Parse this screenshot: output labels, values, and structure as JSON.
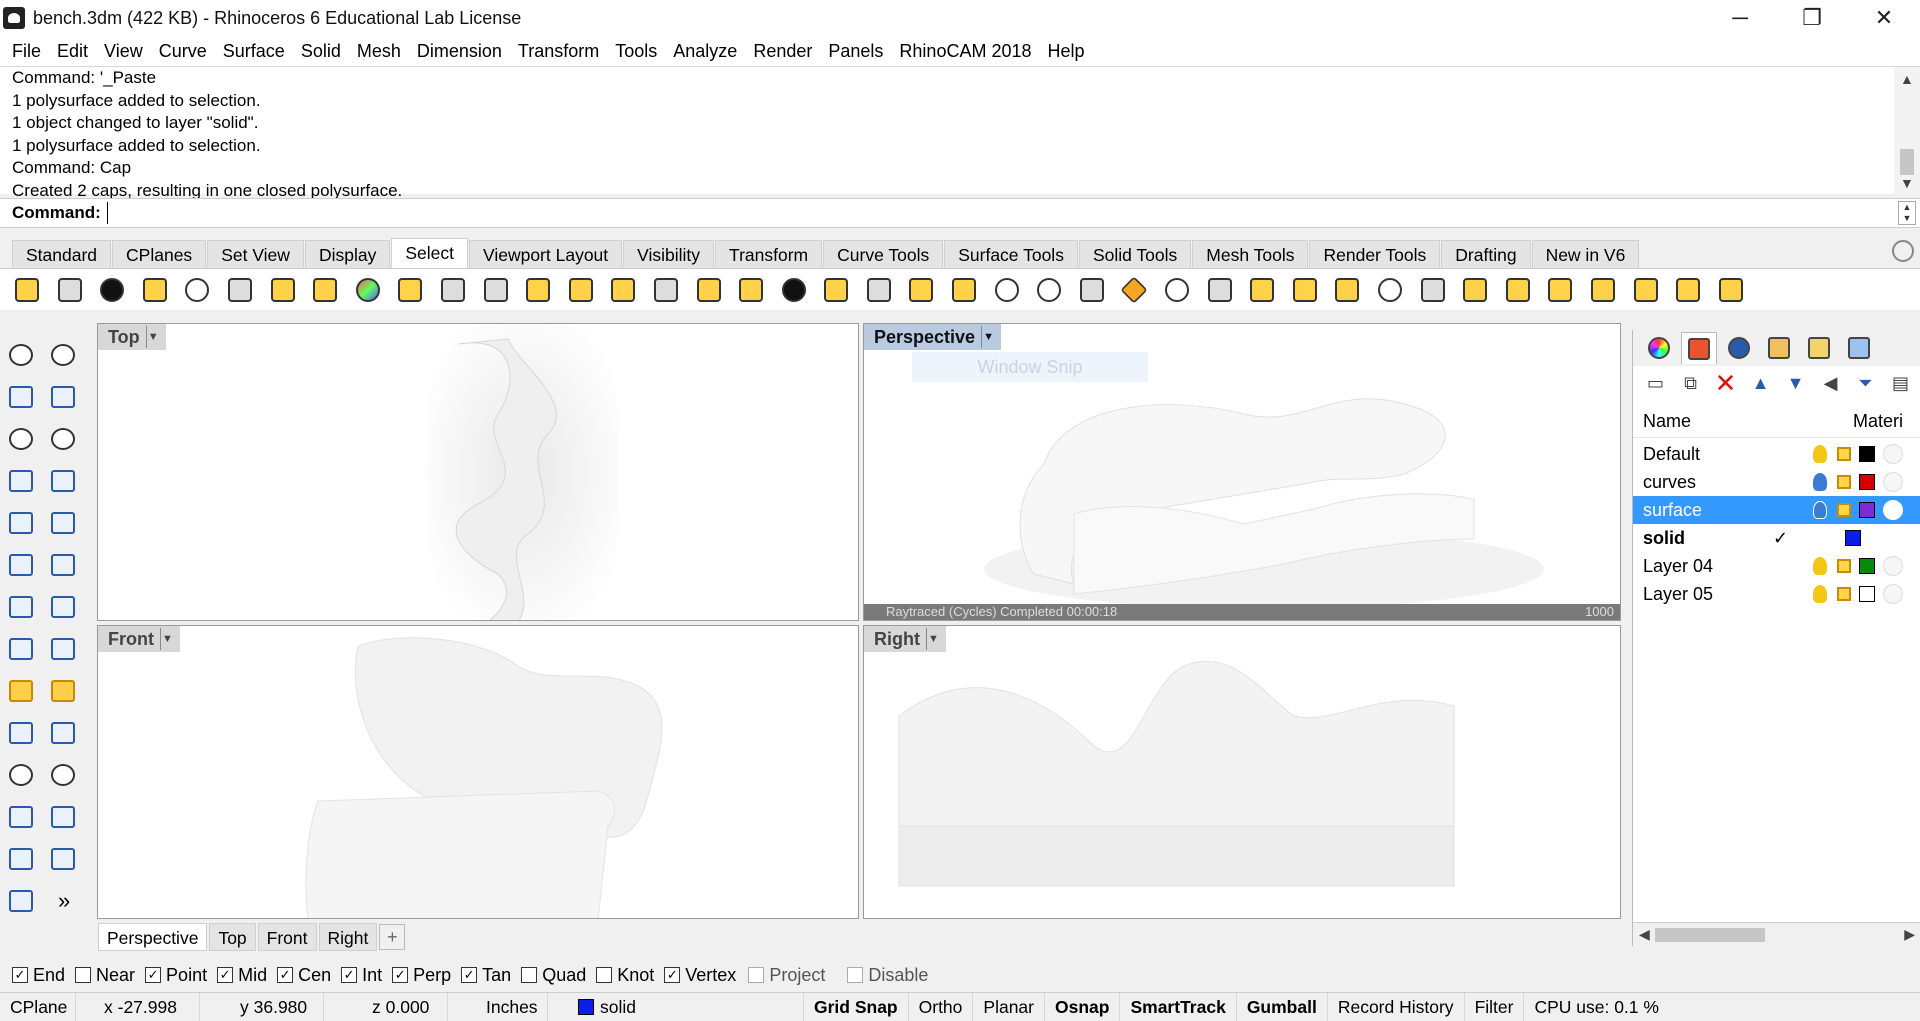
{
  "window": {
    "title": "bench.3dm (422 KB) - Rhinoceros 6 Educational Lab License",
    "minimize": "─",
    "maximize": "❐",
    "close": "✕"
  },
  "menu": [
    "File",
    "Edit",
    "View",
    "Curve",
    "Surface",
    "Solid",
    "Mesh",
    "Dimension",
    "Transform",
    "Tools",
    "Analyze",
    "Render",
    "Panels",
    "RhinoCAM 2018",
    "Help"
  ],
  "command_history": [
    "Command: '_Paste",
    "1 polysurface added to selection.",
    "1 object changed to layer \"solid\".",
    "1 polysurface added to selection.",
    "Command: Cap",
    "Created 2 caps, resulting in one closed polysurface."
  ],
  "command_prompt": {
    "label": "Command:",
    "value": ""
  },
  "toolbar_tabs": [
    "Standard",
    "CPlanes",
    "Set View",
    "Display",
    "Select",
    "Viewport Layout",
    "Visibility",
    "Transform",
    "Curve Tools",
    "Surface Tools",
    "Solid Tools",
    "Mesh Tools",
    "Render Tools",
    "Drafting",
    "New in V6"
  ],
  "active_toolbar_tab": "Select",
  "viewports": {
    "top": {
      "label": "Top"
    },
    "perspective": {
      "label": "Perspective",
      "snip_overlay": "Window Snip",
      "status_left": "Raytraced (Cycles)    Completed    00:00:18",
      "status_right": "1000"
    },
    "front": {
      "label": "Front"
    },
    "right": {
      "label": "Right"
    }
  },
  "viewport_tabs": [
    "Perspective",
    "Top",
    "Front",
    "Right"
  ],
  "layers_panel": {
    "header_name": "Name",
    "header_material": "Materi",
    "layers": [
      {
        "name": "Default",
        "color": "#000000",
        "bulb": "#f5c518"
      },
      {
        "name": "curves",
        "color": "#d40000",
        "bulb": "#3a7bd5"
      },
      {
        "name": "surface",
        "color": "#7a2bd5",
        "bulb": "#3a7bd5",
        "selected": true
      },
      {
        "name": "solid",
        "color": "#0a1fe8",
        "current": true,
        "check": "✓"
      },
      {
        "name": "Layer 04",
        "color": "#0a8a0a",
        "bulb": "#f5c518"
      },
      {
        "name": "Layer 05",
        "color": "#ffffff",
        "bulb": "#f5c518"
      }
    ]
  },
  "osnaps": [
    {
      "label": "End",
      "checked": true
    },
    {
      "label": "Near",
      "checked": false
    },
    {
      "label": "Point",
      "checked": true
    },
    {
      "label": "Mid",
      "checked": true
    },
    {
      "label": "Cen",
      "checked": true
    },
    {
      "label": "Int",
      "checked": true
    },
    {
      "label": "Perp",
      "checked": true
    },
    {
      "label": "Tan",
      "checked": true
    },
    {
      "label": "Quad",
      "checked": false
    },
    {
      "label": "Knot",
      "checked": false
    },
    {
      "label": "Vertex",
      "checked": true
    },
    {
      "label": "Project",
      "checked": false,
      "disabled": true
    },
    {
      "label": "Disable",
      "checked": false,
      "disabled": true
    }
  ],
  "status": {
    "cplane": "CPlane",
    "x": "x -27.998",
    "y": "y 36.980",
    "z": "z 0.000",
    "units": "Inches",
    "layer": "solid",
    "layer_color": "#0a1fe8",
    "grid_snap": "Grid Snap",
    "ortho": "Ortho",
    "planar": "Planar",
    "osnap": "Osnap",
    "smarttrack": "SmartTrack",
    "gumball": "Gumball",
    "record_history": "Record History",
    "filter": "Filter",
    "cpu": "CPU use: 0.1 %"
  },
  "misc": {
    "expand_glyph": "»",
    "add_viewport_glyph": "+"
  }
}
